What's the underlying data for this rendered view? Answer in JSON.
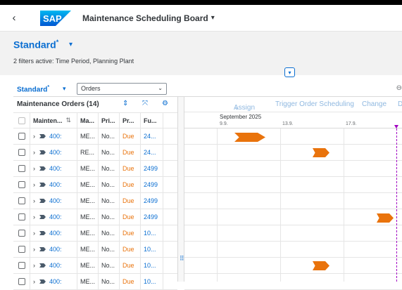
{
  "shell": {
    "back_icon": "chevron-left-icon",
    "logo_text": "SAP",
    "title": "Maintenance Scheduling Board",
    "title_chevron": "⌄"
  },
  "header": {
    "variant": "Standard",
    "variant_mark": "*",
    "filters_text": "2 filters active: Time Period, Planning Plant"
  },
  "toolbar": {
    "variant": "Standard",
    "variant_mark": "*",
    "select_value": "Orders"
  },
  "table": {
    "title": "Maintenance Orders (14)",
    "columns": [
      "Mainten...",
      "Ma...",
      "Pri...",
      "Pr...",
      "Fu..."
    ],
    "rows": [
      {
        "order": "400:",
        "ma": "ME...",
        "pri": "No...",
        "pr": "Due",
        "fu": "24..."
      },
      {
        "order": "400:",
        "ma": "RE...",
        "pri": "No...",
        "pr": "Due",
        "fu": "24..."
      },
      {
        "order": "400:",
        "ma": "ME...",
        "pri": "No...",
        "pr": "Due",
        "fu": "2499"
      },
      {
        "order": "400:",
        "ma": "ME...",
        "pri": "No...",
        "pr": "Due",
        "fu": "2499"
      },
      {
        "order": "400:",
        "ma": "ME...",
        "pri": "No...",
        "pr": "Due",
        "fu": "2499"
      },
      {
        "order": "400:",
        "ma": "ME...",
        "pri": "No...",
        "pr": "Due",
        "fu": "2499"
      },
      {
        "order": "400:",
        "ma": "ME...",
        "pri": "No...",
        "pr": "Due",
        "fu": "10..."
      },
      {
        "order": "400:",
        "ma": "ME...",
        "pri": "No...",
        "pr": "Due",
        "fu": "10..."
      },
      {
        "order": "400:",
        "ma": "ME...",
        "pri": "No...",
        "pr": "Due",
        "fu": "10..."
      },
      {
        "order": "400:",
        "ma": "ME...",
        "pri": "No...",
        "pr": "Due",
        "fu": "10..."
      }
    ]
  },
  "gantt": {
    "toolbar": {
      "assign": "Assign",
      "assign_chev": "⌄",
      "trigger": "Trigger Order Scheduling",
      "change": "Change",
      "more": "D"
    },
    "month": "September 2025",
    "ticks": [
      "9.9.",
      "13.9.",
      "17.9."
    ]
  },
  "colors": {
    "accent": "#0a6ed1",
    "due": "#e9730c",
    "bar": "#e9730c",
    "today": "#a100c2"
  }
}
